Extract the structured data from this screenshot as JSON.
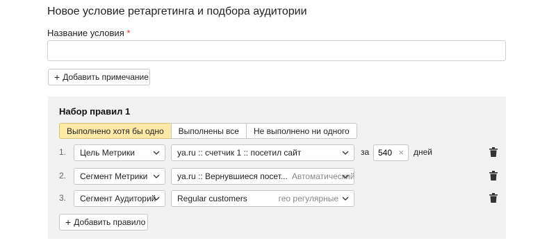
{
  "page": {
    "title": "Новое условие ретаргетинга и подбора аудитории"
  },
  "name_field": {
    "label": "Название условия",
    "required_mark": "*",
    "value": "",
    "placeholder": ""
  },
  "add_note": {
    "plus": "+",
    "label": "Добавить примечание"
  },
  "ruleset": {
    "title": "Набор правил 1",
    "modes": [
      {
        "label": "Выполнено хотя бы одно",
        "active": true
      },
      {
        "label": "Выполнены все",
        "active": false
      },
      {
        "label": "Не выполнено ни одного",
        "active": false
      }
    ],
    "rules": [
      {
        "num": "1.",
        "type": "Цель Метрики",
        "value": "ya.ru :: счетчик 1 :: посетил сайт",
        "value_extra": "",
        "za": "за",
        "days": "540",
        "clear": "×",
        "days_label": "дней"
      },
      {
        "num": "2.",
        "type": "Сегмент Метрики",
        "value": "ya.ru :: Вернувшиеся посет...",
        "value_extra": "Автоматический"
      },
      {
        "num": "3.",
        "type": "Сегмент Аудиторий",
        "value": "Regular customers",
        "value_extra": "гео регулярные"
      }
    ],
    "add_rule": {
      "plus": "+",
      "label": "Добавить правило"
    }
  },
  "icons": {
    "trash": "trash-icon",
    "chevron": "chevron-down-icon"
  }
}
